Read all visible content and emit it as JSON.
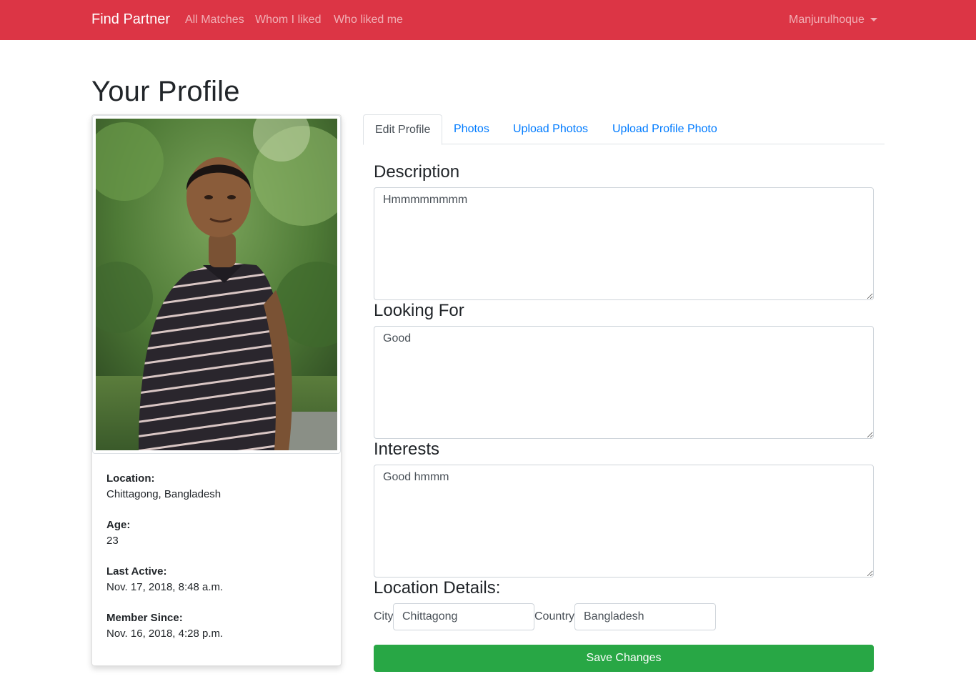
{
  "navbar": {
    "brand": "Find Partner",
    "links": [
      "All Matches",
      "Whom I liked",
      "Who liked me"
    ],
    "user": "Manjurulhoque",
    "background_color": "#dc3545"
  },
  "page_title": "Your Profile",
  "profile_card": {
    "photo_alt": "profile-photo",
    "info": [
      {
        "label": "Location:",
        "value": "Chittagong, Bangladesh"
      },
      {
        "label": "Age:",
        "value": "23"
      },
      {
        "label": "Last Active:",
        "value": "Nov. 17, 2018, 8:48 a.m."
      },
      {
        "label": "Member Since:",
        "value": "Nov. 16, 2018, 4:28 p.m."
      }
    ]
  },
  "tabs": [
    {
      "label": "Edit Profile",
      "active": true
    },
    {
      "label": "Photos",
      "active": false
    },
    {
      "label": "Upload Photos",
      "active": false
    },
    {
      "label": "Upload Profile Photo",
      "active": false
    }
  ],
  "form": {
    "description": {
      "heading": "Description",
      "value": "Hmmmmmmmm"
    },
    "looking_for": {
      "heading": "Looking For",
      "value": "Good"
    },
    "interests": {
      "heading": "Interests",
      "value": "Good hmmm"
    },
    "location": {
      "heading": "Location Details:",
      "city_label": "City",
      "city_value": "Chittagong",
      "country_label": "Country",
      "country_value": "Bangladesh"
    },
    "save_label": "Save Changes",
    "save_color": "#28a745"
  }
}
